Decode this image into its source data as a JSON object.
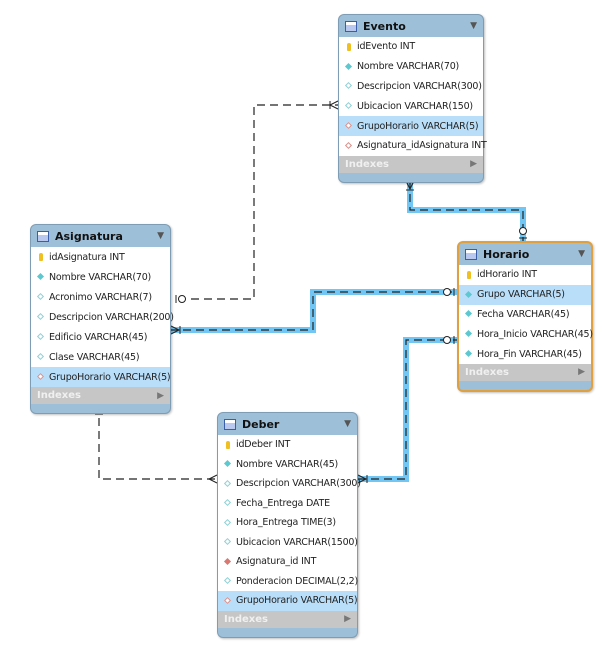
{
  "colors": {
    "relationship_highlight": "#4fb8f0",
    "table_header": "#9dbfd8",
    "selected_border": "#e0a040",
    "row_highlight": "#b9defa"
  },
  "indexes_label": "Indexes",
  "tables": [
    {
      "id": "evento",
      "name": "Evento",
      "selected": false,
      "columns": [
        {
          "text": "idEvento INT",
          "icon": "pk"
        },
        {
          "text": "Nombre VARCHAR(70)",
          "icon": "nn"
        },
        {
          "text": "Descripcion VARCHAR(300)",
          "icon": "col"
        },
        {
          "text": "Ubicacion VARCHAR(150)",
          "icon": "col"
        },
        {
          "text": "GrupoHorario VARCHAR(5)",
          "icon": "fk",
          "highlighted": true
        },
        {
          "text": "Asignatura_idAsignatura INT",
          "icon": "fk"
        }
      ]
    },
    {
      "id": "asignatura",
      "name": "Asignatura",
      "selected": false,
      "columns": [
        {
          "text": "idAsignatura INT",
          "icon": "pk"
        },
        {
          "text": "Nombre VARCHAR(70)",
          "icon": "nn"
        },
        {
          "text": "Acronimo VARCHAR(7)",
          "icon": "col"
        },
        {
          "text": "Descripcion VARCHAR(200)",
          "icon": "col"
        },
        {
          "text": "Edificio VARCHAR(45)",
          "icon": "col"
        },
        {
          "text": "Clase VARCHAR(45)",
          "icon": "col"
        },
        {
          "text": "GrupoHorario VARCHAR(5)",
          "icon": "fk",
          "highlighted": true
        }
      ]
    },
    {
      "id": "horario",
      "name": "Horario",
      "selected": true,
      "columns": [
        {
          "text": "idHorario INT",
          "icon": "pk"
        },
        {
          "text": "Grupo VARCHAR(5)",
          "icon": "nn",
          "highlighted": true
        },
        {
          "text": "Fecha VARCHAR(45)",
          "icon": "nn"
        },
        {
          "text": "Hora_Inicio VARCHAR(45)",
          "icon": "nn"
        },
        {
          "text": "Hora_Fin VARCHAR(45)",
          "icon": "nn"
        }
      ]
    },
    {
      "id": "deber",
      "name": "Deber",
      "selected": false,
      "columns": [
        {
          "text": "idDeber INT",
          "icon": "pk"
        },
        {
          "text": "Nombre VARCHAR(45)",
          "icon": "nn"
        },
        {
          "text": "Descripcion VARCHAR(300)",
          "icon": "col"
        },
        {
          "text": "Fecha_Entrega DATE",
          "icon": "col"
        },
        {
          "text": "Hora_Entrega TIME(3)",
          "icon": "col"
        },
        {
          "text": "Ubicacion VARCHAR(1500)",
          "icon": "col"
        },
        {
          "text": "Asignatura_id INT",
          "icon": "fkn"
        },
        {
          "text": "Ponderacion DECIMAL(2,2)",
          "icon": "col"
        },
        {
          "text": "GrupoHorario VARCHAR(5)",
          "icon": "fk",
          "highlighted": true
        }
      ]
    }
  ],
  "relationships": [
    {
      "from": "asignatura",
      "to": "evento",
      "highlighted": false
    },
    {
      "from": "horario",
      "to": "evento",
      "highlighted": true
    },
    {
      "from": "horario",
      "to": "asignatura",
      "highlighted": true
    },
    {
      "from": "horario",
      "to": "deber",
      "highlighted": true
    },
    {
      "from": "asignatura",
      "to": "deber",
      "highlighted": false
    }
  ]
}
